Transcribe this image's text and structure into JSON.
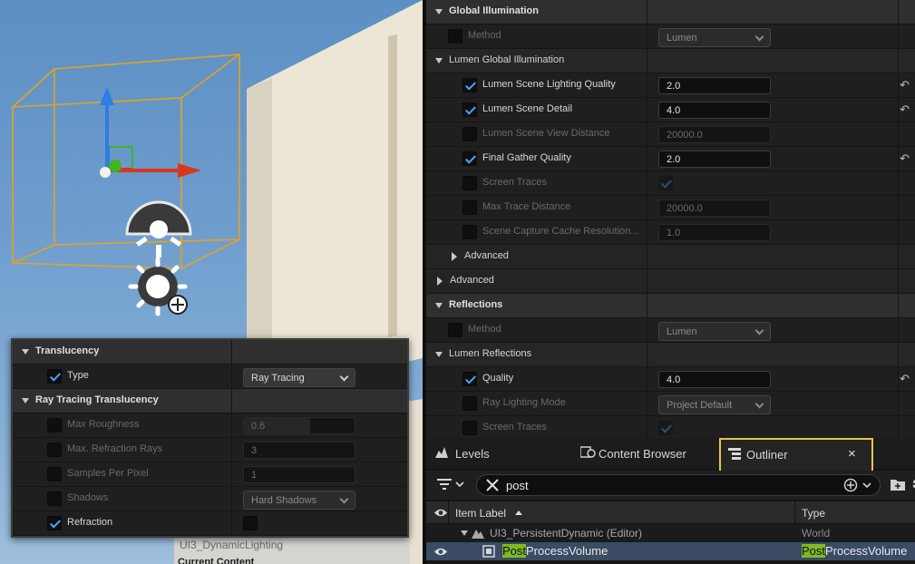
{
  "viewport": {
    "caption_level": "UI3_DynamicLighting",
    "caption_content": "Current Content"
  },
  "translucency_panel": {
    "sections": [
      {
        "kind": "cat",
        "label": "Translucency"
      },
      {
        "kind": "prop",
        "label": "Type",
        "checked": true,
        "enabled": true,
        "control": "dropdown",
        "value": "Ray Tracing"
      },
      {
        "kind": "cat",
        "label": "Ray Tracing Translucency"
      },
      {
        "kind": "prop",
        "label": "Max Roughness",
        "checked": false,
        "enabled": false,
        "control": "slider",
        "value": "0.6",
        "fill": 0.6
      },
      {
        "kind": "prop",
        "label": "Max. Refraction Rays",
        "checked": false,
        "enabled": false,
        "control": "field",
        "value": "3"
      },
      {
        "kind": "prop",
        "label": "Samples Per Pixel",
        "checked": false,
        "enabled": false,
        "control": "field",
        "value": "1"
      },
      {
        "kind": "prop",
        "label": "Shadows",
        "checked": false,
        "enabled": false,
        "control": "dropdown",
        "value": "Hard Shadows"
      },
      {
        "kind": "prop",
        "label": "Refraction",
        "checked": true,
        "enabled": true,
        "control": "checkbox",
        "value_checked": false
      }
    ]
  },
  "details": {
    "rows": [
      {
        "kind": "cat",
        "label": "Global Illumination"
      },
      {
        "kind": "prop",
        "indent": 0,
        "label": "Method",
        "checked": false,
        "enabled": false,
        "control": "dropdown",
        "value": "Lumen",
        "reset": false
      },
      {
        "kind": "sub",
        "label": "Lumen Global Illumination"
      },
      {
        "kind": "prop",
        "indent": 1,
        "label": "Lumen Scene Lighting Quality",
        "checked": true,
        "enabled": true,
        "control": "field",
        "value": "2.0",
        "reset": true
      },
      {
        "kind": "prop",
        "indent": 1,
        "label": "Lumen Scene Detail",
        "checked": true,
        "enabled": true,
        "control": "field",
        "value": "4.0",
        "reset": true
      },
      {
        "kind": "prop",
        "indent": 1,
        "label": "Lumen Scene View Distance",
        "checked": false,
        "enabled": false,
        "control": "field",
        "value": "20000.0",
        "reset": false
      },
      {
        "kind": "prop",
        "indent": 1,
        "label": "Final Gather Quality",
        "checked": true,
        "enabled": true,
        "control": "field",
        "value": "2.0",
        "reset": true
      },
      {
        "kind": "prop",
        "indent": 1,
        "label": "Screen Traces",
        "checked": false,
        "enabled": false,
        "control": "checkbox",
        "value_checked": true,
        "reset": false
      },
      {
        "kind": "prop",
        "indent": 1,
        "label": "Max Trace Distance",
        "checked": false,
        "enabled": false,
        "control": "field",
        "value": "20000.0",
        "reset": false
      },
      {
        "kind": "prop",
        "indent": 1,
        "label": "Scene Capture Cache Resolution...",
        "checked": false,
        "enabled": false,
        "control": "field",
        "value": "1.0",
        "reset": false
      },
      {
        "kind": "adv",
        "indent": 1,
        "label": "Advanced"
      },
      {
        "kind": "adv",
        "indent": 0,
        "label": "Advanced"
      },
      {
        "kind": "cat",
        "label": "Reflections"
      },
      {
        "kind": "prop",
        "indent": 0,
        "label": "Method",
        "checked": false,
        "enabled": false,
        "control": "dropdown",
        "value": "Lumen",
        "reset": false
      },
      {
        "kind": "sub",
        "label": "Lumen Reflections"
      },
      {
        "kind": "prop",
        "indent": 1,
        "label": "Quality",
        "checked": true,
        "enabled": true,
        "control": "field",
        "value": "4.0",
        "reset": true
      },
      {
        "kind": "prop",
        "indent": 1,
        "label": "Ray Lighting Mode",
        "checked": false,
        "enabled": false,
        "control": "dropdown",
        "value": "Project Default",
        "reset": false
      },
      {
        "kind": "prop",
        "indent": 1,
        "label": "Screen Traces",
        "checked": false,
        "enabled": false,
        "control": "checkbox",
        "value_checked": true,
        "reset": false
      }
    ]
  },
  "tabs": {
    "levels": "Levels",
    "content_browser": "Content Browser",
    "outliner": "Outliner",
    "close": "×"
  },
  "outliner": {
    "search_value": "post",
    "col_label": "Item Label",
    "col_type": "Type",
    "rows": [
      {
        "label": "UI3_PersistentDynamic (Editor)",
        "type": "World"
      },
      {
        "label_match": "Post",
        "label_rest": "ProcessVolume",
        "type_match": "Post",
        "type_rest": "ProcessVolume"
      }
    ]
  },
  "colors": {
    "accent_check": "#4ea5ff",
    "highlight_outline": "#e8c547",
    "search_match": "#7fb929",
    "gizmo_x": "#d9361e",
    "gizmo_y": "#3fb61e",
    "gizmo_z": "#2f7de0",
    "bounds": "#e2a321"
  }
}
